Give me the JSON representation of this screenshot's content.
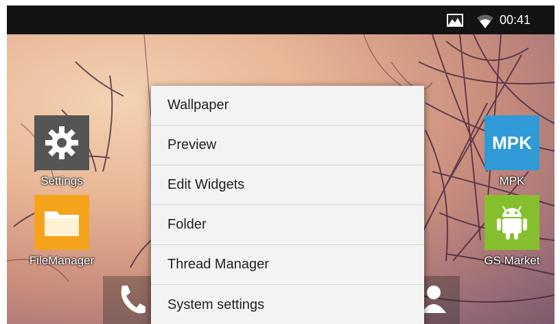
{
  "status_bar": {
    "time": "00:41",
    "image_icon": "image-icon",
    "wifi_icon": "wifi-icon"
  },
  "apps": {
    "settings": {
      "label": "Settings",
      "icon": "gear-icon"
    },
    "filemanager": {
      "label": "FileManager",
      "icon": "folder-icon"
    },
    "mpk": {
      "label": "MPK",
      "tile_text": "MPK"
    },
    "gsmarket": {
      "label": "GS Market",
      "icon": "android-icon"
    }
  },
  "dock": {
    "phone_icon": "phone-icon",
    "contacts_icon": "contacts-icon"
  },
  "context_menu": {
    "items": [
      {
        "label": "Wallpaper"
      },
      {
        "label": "Preview"
      },
      {
        "label": "Edit Widgets"
      },
      {
        "label": "Folder"
      },
      {
        "label": "Thread Manager"
      },
      {
        "label": "System settings"
      }
    ]
  },
  "colors": {
    "settings_tile": "#555555",
    "filemanager_tile": "#f5a31a",
    "mpk_tile": "#2f9ad6",
    "gsmarket_tile": "#86bf2e",
    "status_bar": "#131313",
    "menu_bg": "#f3f3f3"
  }
}
